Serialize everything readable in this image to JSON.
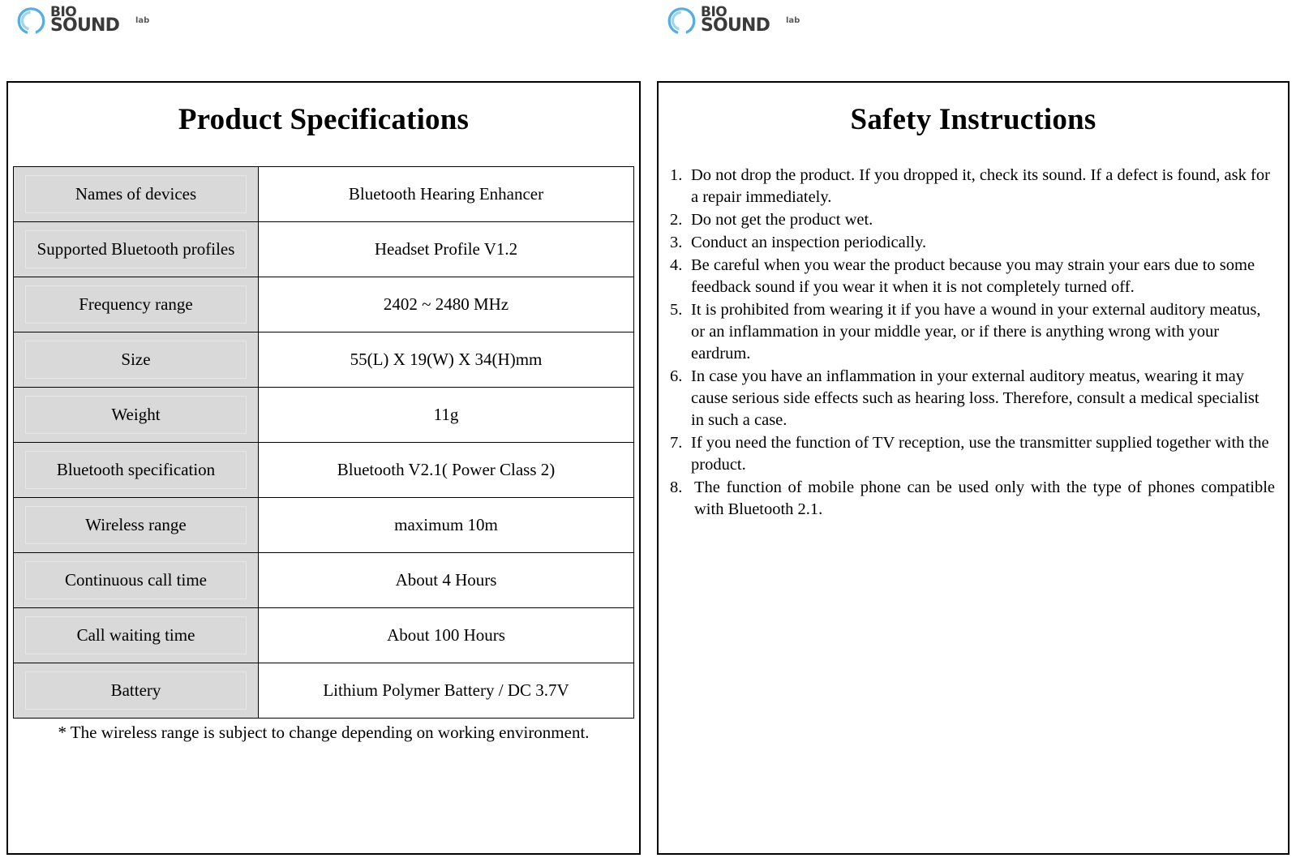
{
  "brand": {
    "name_line1": "BIO",
    "name_line2": "SOUND",
    "suffix": "lab",
    "mark_color": "#57ADDF",
    "word_color": "#3a3a3a"
  },
  "left_panel": {
    "title": "Product Specifications",
    "table": {
      "rows": [
        {
          "label": "Names of devices",
          "value": "Bluetooth Hearing Enhancer"
        },
        {
          "label": "Supported Bluetooth profiles",
          "value": "Headset Profile V1.2"
        },
        {
          "label": "Frequency range",
          "value": "2402 ~ 2480 MHz"
        },
        {
          "label": "Size",
          "value": "55(L) X 19(W) X 34(H)mm"
        },
        {
          "label": "Weight",
          "value": "11g"
        },
        {
          "label": "Bluetooth specification",
          "value": "Bluetooth V2.1( Power Class 2)"
        },
        {
          "label": "Wireless range",
          "value": "maximum 10m"
        },
        {
          "label": "Continuous call time",
          "value": "About 4 Hours"
        },
        {
          "label": "Call waiting time",
          "value": "About 100 Hours"
        },
        {
          "label": "Battery",
          "value": "Lithium Polymer Battery / DC 3.7V"
        }
      ]
    },
    "note": "* The wireless range is subject to change depending on working environment."
  },
  "right_panel": {
    "title": "Safety Instructions",
    "instructions": [
      {
        "number": "1.",
        "text": "Do not drop the product. If you dropped it, check its sound. If a defect is found, ask for a repair immediately."
      },
      {
        "number": "2.",
        "text": "Do not get the product wet."
      },
      {
        "number": "3.",
        "text": "Conduct an inspection periodically."
      },
      {
        "number": "4.",
        "text": "Be careful when you wear the product because you may strain your ears due to some feedback sound if you wear it when it is not completely turned off."
      },
      {
        "number": "5.",
        "text": "It is prohibited from wearing it if you have a wound in your external auditory meatus, or an inflammation in your middle year, or if there is anything wrong with your eardrum."
      },
      {
        "number": "6.",
        "text": "In case you have an inflammation in your external auditory meatus, wearing it may cause serious side effects such as hearing loss. Therefore, consult a medical specialist in such a case."
      },
      {
        "number": "7.",
        "text": "If you need the function of TV reception, use the transmitter supplied together with the product."
      },
      {
        "number": "8.",
        "text": "The function of mobile phone can be used only with the type of phones compatible with Bluetooth 2.1."
      }
    ]
  }
}
